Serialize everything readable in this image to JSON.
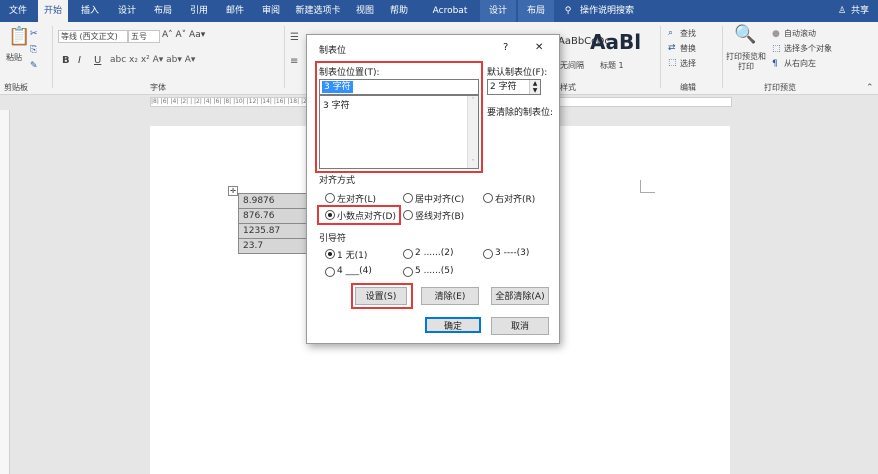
{
  "ribbon_tabs": [
    "文件",
    "开始",
    "插入",
    "设计",
    "布局",
    "引用",
    "邮件",
    "审阅",
    "新建选项卡",
    "视图",
    "帮助",
    "Acrobat",
    "设计",
    "布局",
    "操作说明搜索",
    "共享"
  ],
  "ribbon": {
    "paste": "粘贴",
    "clipboard": "剪贴板",
    "font_name": "等线 (西文正文)",
    "font_size": "五号",
    "font_group": "字体",
    "bold": "B",
    "italic": "I",
    "underline": "U",
    "styles_sample1": "AaBbCcDc",
    "styles_sample2": "AaBl",
    "style_label1": "无间隔",
    "style_label2": "标题 1",
    "styles_group": "样式",
    "find": "查找",
    "replace": "替换",
    "select": "选择",
    "edit_group": "编辑",
    "print_preview": "打印预览和打印",
    "auto_scroll": "自动滚动",
    "select_objects": "选择多个对象",
    "rtl": "从右向左",
    "print_group": "打印预览"
  },
  "ruler_text": "|8| |6| |4| |2| | |2| |4| |6| |8| |10| |12| |14| |16| |18| |20| |22| |24| |26| |28| |30| |32| |34| |36| |38| |40| |42| |44| |46|",
  "table": [
    [
      "8.9876",
      ""
    ],
    [
      "876.76",
      ""
    ],
    [
      "1235.87",
      ""
    ],
    [
      "23.7",
      ""
    ]
  ],
  "dialog": {
    "title": "制表位",
    "help": "?",
    "close": "✕",
    "tab_pos_label": "制表位位置(T):",
    "tab_pos_value": "3 字符",
    "tab_list": [
      "3 字符"
    ],
    "default_label": "默认制表位(F):",
    "default_value": "2 字符",
    "clear_label": "要清除的制表位:",
    "align_label": "对齐方式",
    "align": [
      {
        "label": "左对齐(L)",
        "on": false
      },
      {
        "label": "居中对齐(C)",
        "on": false
      },
      {
        "label": "右对齐(R)",
        "on": false
      },
      {
        "label": "小数点对齐(D)",
        "on": true
      },
      {
        "label": "竖线对齐(B)",
        "on": false
      }
    ],
    "leader_label": "引导符",
    "leader": [
      {
        "label": "1 无(1)",
        "on": true
      },
      {
        "label": "2 ......(2)",
        "on": false
      },
      {
        "label": "3 ----(3)",
        "on": false
      },
      {
        "label": "4 ___(4)",
        "on": false
      },
      {
        "label": "5 ......(5)",
        "on": false
      }
    ],
    "set": "设置(S)",
    "clear": "清除(E)",
    "clear_all": "全部清除(A)",
    "ok": "确定",
    "cancel": "取消"
  }
}
